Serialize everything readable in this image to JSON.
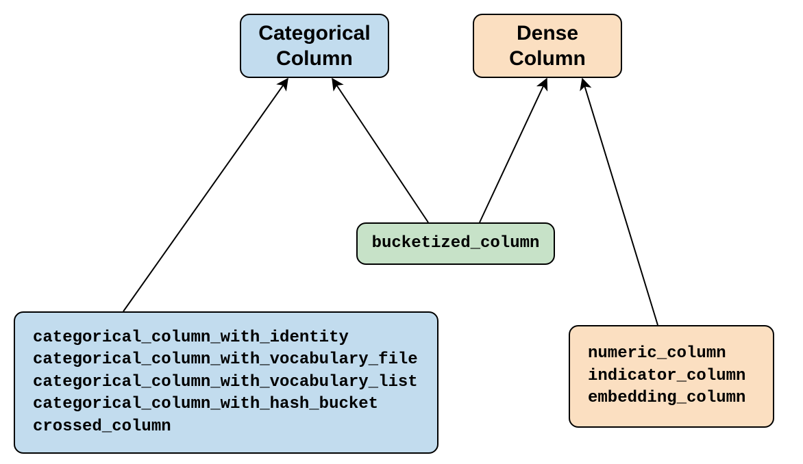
{
  "nodes": {
    "categorical": {
      "line1": "Categorical",
      "line2": "Column"
    },
    "dense": {
      "line1": "Dense",
      "line2": "Column"
    },
    "bucketized": {
      "label": "bucketized_column"
    },
    "cat_list": {
      "l0": "categorical_column_with_identity",
      "l1": "categorical_column_with_vocabulary_file",
      "l2": "categorical_column_with_vocabulary_list",
      "l3": "categorical_column_with_hash_bucket",
      "l4": "crossed_column"
    },
    "dense_list": {
      "l0": "numeric_column",
      "l1": "indicator_column",
      "l2": "embedding_column"
    }
  },
  "colors": {
    "blue": "#c2dcee",
    "green": "#c7e2c8",
    "peach": "#fbdfc1",
    "stroke": "#000000"
  },
  "edges": [
    {
      "from": "cat_list",
      "to": "categorical"
    },
    {
      "from": "bucketized",
      "to": "categorical"
    },
    {
      "from": "bucketized",
      "to": "dense"
    },
    {
      "from": "dense_list",
      "to": "dense"
    }
  ]
}
